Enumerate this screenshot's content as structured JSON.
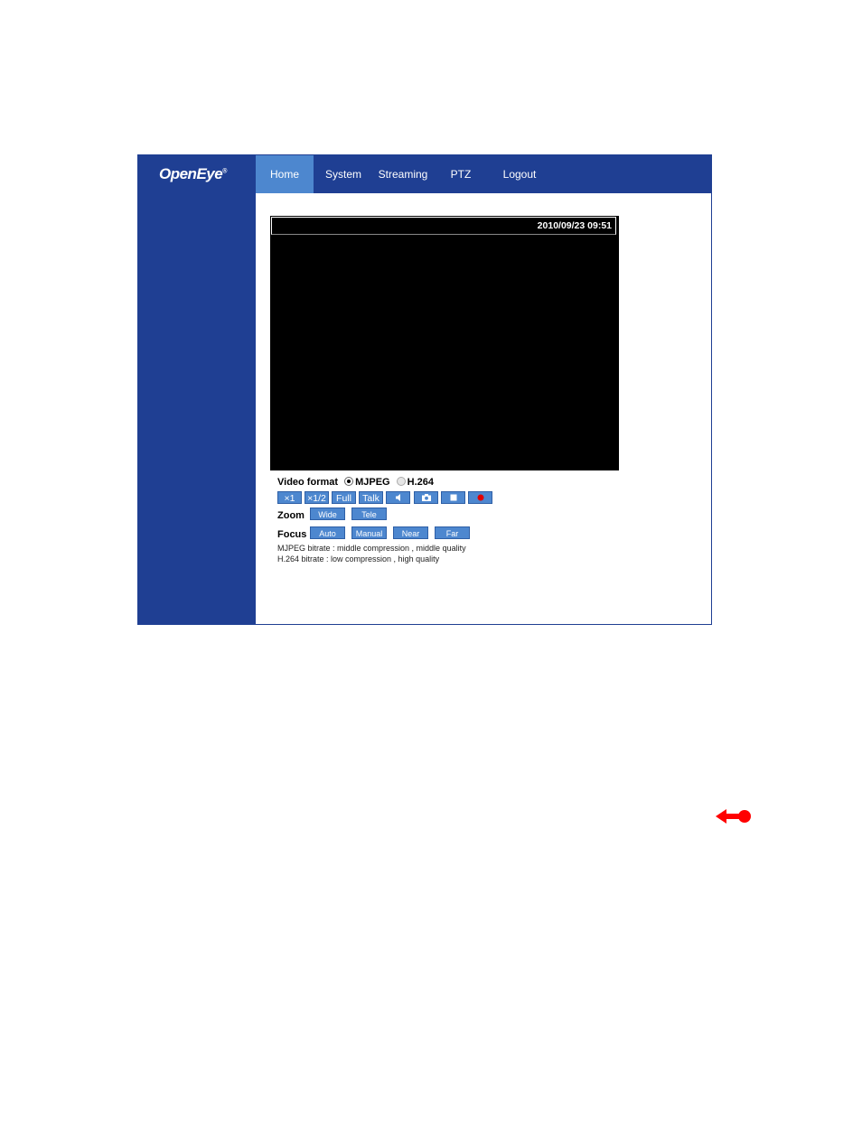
{
  "logo": {
    "text": "OpenEye",
    "mark": "®"
  },
  "nav": {
    "items": [
      {
        "label": "Home",
        "active": true
      },
      {
        "label": "System",
        "active": false
      },
      {
        "label": "Streaming",
        "active": false
      },
      {
        "label": "PTZ",
        "active": false
      },
      {
        "label": "Logout",
        "active": false
      }
    ]
  },
  "video": {
    "timestamp": "2010/09/23 09:51"
  },
  "video_format": {
    "label": "Video format",
    "options": [
      {
        "label": "MJPEG",
        "selected": true
      },
      {
        "label": "H.264",
        "selected": false
      }
    ]
  },
  "view_buttons": {
    "x1": "×1",
    "x1_2": "×1/2",
    "full": "Full",
    "talk": "Talk",
    "speaker_icon": "speaker-icon",
    "snapshot_icon": "camera-icon",
    "stop_icon": "stop-icon",
    "record_icon": "record-icon"
  },
  "zoom": {
    "label": "Zoom",
    "wide": "Wide",
    "tele": "Tele"
  },
  "focus": {
    "label": "Focus",
    "auto": "Auto",
    "manual": "Manual",
    "near": "Near",
    "far": "Far"
  },
  "info": {
    "mjpeg": "MJPEG bitrate : middle compression , middle quality",
    "h264": "H.264 bitrate : low compression , high quality"
  },
  "colors": {
    "brand": "#1f3f93",
    "accent": "#4d87cf",
    "record": "#e00000",
    "page_arrow": "#ff0000"
  },
  "page_nav_icon": "back-arrow-icon"
}
